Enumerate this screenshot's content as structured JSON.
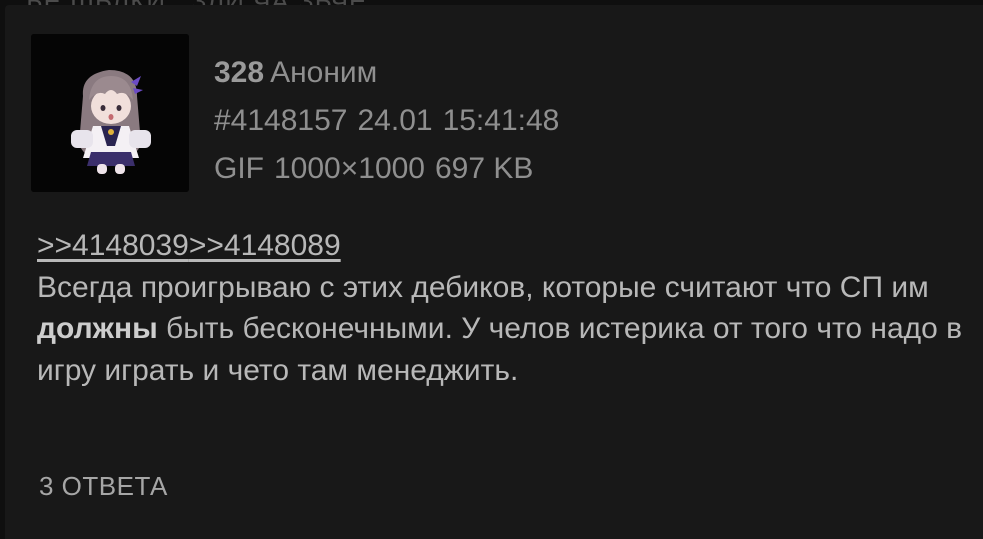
{
  "background_text": "ЪЕ ШЬЛКИ...ЗЛИ ЧА ЗЬЧЕ",
  "post": {
    "number": "328",
    "author": "Аноним",
    "post_id": "#4148157",
    "date": "24.01",
    "time": "15:41:48",
    "file_type": "GIF",
    "file_dimensions": "1000×1000",
    "file_size": "697 KB",
    "reply_links": [
      ">>4148039",
      ">>4148089"
    ],
    "text_part1": "Всегда проигрываю с этих дебиков, которые считают что СП им ",
    "text_bold": "должны",
    "text_part2": " быть бесконечными. У челов истерика от того что надо в игру играть и чето там менеджить.",
    "replies_label": "3 ОТВЕТА"
  },
  "colors": {
    "background": "#181818",
    "meta_text": "#8f8f8f",
    "body_text": "#b8b8b8"
  }
}
